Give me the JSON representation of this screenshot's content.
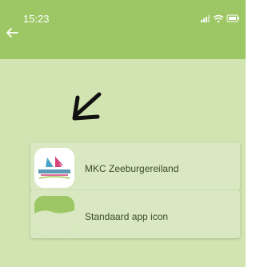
{
  "status_bar": {
    "time": "15:23",
    "icons": [
      "signal-icon",
      "wifi-icon",
      "battery-icon"
    ]
  },
  "header": {
    "back_icon": "arrow-left-icon"
  },
  "options": [
    {
      "label": "MKC Zeeburgereiland",
      "icon": "mkc-logo-icon"
    },
    {
      "label": "Standaard app icon",
      "icon": "standard-app-icon"
    }
  ],
  "colors": {
    "appbar": "#9dc764",
    "background": "#d2e4b2",
    "card": "#d9e8c1"
  }
}
